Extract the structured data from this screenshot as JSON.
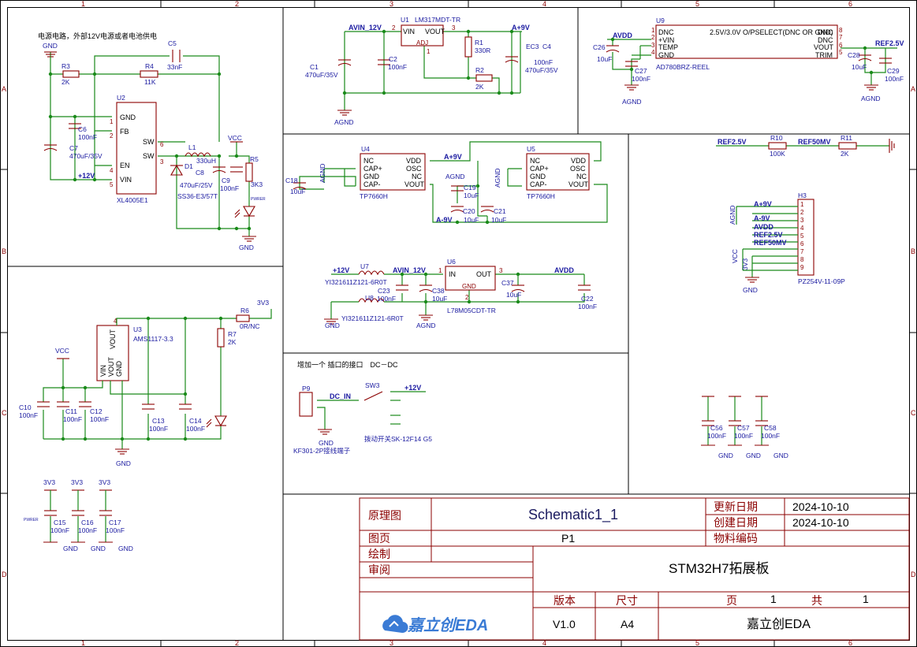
{
  "sheet": {
    "col_markers": [
      "1",
      "2",
      "3",
      "4",
      "5",
      "6"
    ],
    "row_markers": [
      "A",
      "B",
      "C",
      "D"
    ]
  },
  "power_section": {
    "note": "电源电路，外部12V电源或者电池供电",
    "parts": {
      "c5": {
        "ref": "C5",
        "value": "33nF"
      },
      "r3": {
        "ref": "R3",
        "value": "2K"
      },
      "r4": {
        "ref": "R4",
        "value": "11K"
      },
      "u2": {
        "ref": "U2",
        "value": "XL4005E1",
        "pins": [
          "GND",
          "FB",
          "EN",
          "VIN",
          "SW",
          "SW"
        ],
        "pin_numbers": [
          "1",
          "2",
          "4",
          "5",
          "6",
          "3"
        ]
      },
      "c6": {
        "ref": "C6",
        "value": "100nF"
      },
      "c7": {
        "ref": "C7",
        "value": "470uF/35V"
      },
      "l1": {
        "ref": "L1",
        "value": "330uH"
      },
      "d1": {
        "ref": "D1",
        "value": "SS36-E3/57T"
      },
      "c8": {
        "ref": "C8",
        "value": "470uF/25V"
      },
      "c9": {
        "ref": "C9",
        "value": "100nF"
      },
      "r5": {
        "ref": "R5",
        "value": "3K3"
      },
      "led": {
        "value": "PWRER"
      }
    },
    "nets": {
      "gnd": "GND",
      "vcc": "VCC",
      "v12": "+12V"
    }
  },
  "ldo_section": {
    "nets": {
      "avin": "AVIN_12V",
      "a9": "A+9V",
      "agnd": "AGND"
    },
    "parts": {
      "u1": {
        "ref": "U1",
        "value": "LM317MDT-TR",
        "pins": [
          "VIN",
          "VOUT",
          "ADJ"
        ],
        "pin_numbers": [
          "2",
          "3",
          "1"
        ]
      },
      "c1": {
        "ref": "C1",
        "value": "470uF/35V"
      },
      "c2": {
        "ref": "C2",
        "value": "100nF"
      },
      "r1": {
        "ref": "R1",
        "value": "330R"
      },
      "r2": {
        "ref": "R2",
        "value": "2K"
      },
      "ec3": {
        "ref": "EC3",
        "value": ""
      },
      "c4": {
        "ref": "C4",
        "value": "100nF"
      },
      "c4b": {
        "value": "470uF/35V"
      }
    }
  },
  "ref_section": {
    "nets": {
      "avdd": "AVDD",
      "ref25": "REF2.5V",
      "agnd": "AGND"
    },
    "parts": {
      "u9": {
        "ref": "U9",
        "value": "AD780BRZ-REEL",
        "title": "2.5V/3.0V O/PSELECT(DNC OR GND)",
        "pins_left": [
          "DNC",
          "+VIN",
          "TEMP",
          "GND"
        ],
        "pins_right": [
          "DNC",
          "DNC",
          "VOUT",
          "TRIM"
        ],
        "pin_left_numbers": [
          "1",
          "2",
          "3",
          "4"
        ],
        "pin_right_numbers": [
          "8",
          "7",
          "6",
          "5"
        ]
      },
      "c26": {
        "ref": "C26",
        "value": "10uF"
      },
      "c27": {
        "ref": "C27",
        "value": "100nF"
      },
      "c28": {
        "ref": "C28",
        "value": "10uF"
      },
      "c29": {
        "ref": "C29",
        "value": "100nF"
      }
    }
  },
  "inverter_section": {
    "nets": {
      "a9": "A+9V",
      "am9": "A-9V",
      "agnd": "AGND"
    },
    "parts": {
      "u4": {
        "ref": "U4",
        "value": "TP7660H",
        "pins_left": [
          "NC",
          "CAP+",
          "GND",
          "CAP-"
        ],
        "pins_right": [
          "VDD",
          "OSC",
          "NC",
          "VOUT"
        ]
      },
      "u5": {
        "ref": "U5",
        "value": "TP7660H",
        "pins_left": [
          "NC",
          "CAP+",
          "GND",
          "CAP-"
        ],
        "pins_right": [
          "VDD",
          "OSC",
          "NC",
          "VOUT"
        ]
      },
      "c18": {
        "ref": "C18",
        "value": "10uF"
      },
      "c19": {
        "ref": "C19",
        "value": "10uF"
      },
      "c20": {
        "ref": "C20",
        "value": "10uF"
      },
      "c21": {
        "ref": "C21",
        "value": "10uF"
      }
    }
  },
  "divider_section": {
    "nets": {
      "ref25": "REF2.5V",
      "ref50": "REF50MV"
    },
    "parts": {
      "r10": {
        "ref": "R10",
        "value": "100K"
      },
      "r11": {
        "ref": "R11",
        "value": "2K"
      }
    }
  },
  "header_section": {
    "ref": "H3",
    "value": "PZ254V-11-09P",
    "signals": [
      "AGND",
      "A+9V",
      "A-9V",
      "AVDD",
      "REF2.5V",
      "REF50MV",
      "VCC",
      "3V3"
    ],
    "pin_numbers": [
      "1",
      "2",
      "3",
      "4",
      "5",
      "6",
      "7",
      "8",
      "9"
    ],
    "gnd": "GND"
  },
  "filter_section": {
    "nets": {
      "v12": "+12V",
      "avin": "AVIN_12V",
      "avdd": "AVDD",
      "gnd": "GND",
      "agnd": "AGND"
    },
    "parts": {
      "u7": {
        "ref": "U7",
        "value": "YI321611Z121-6R0T"
      },
      "u8": {
        "ref": "U8",
        "value": "YI321611Z121-6R0T"
      },
      "c23": {
        "ref": "C23",
        "value": "100nF"
      },
      "u6": {
        "ref": "U6",
        "value": "L78M05CDT-TR",
        "pins": [
          "IN",
          "OUT",
          "GND"
        ],
        "pin_numbers": [
          "1",
          "3",
          "2"
        ]
      },
      "c38": {
        "ref": "C38",
        "value": "10uF"
      },
      "c37": {
        "ref": "C37",
        "value": "10uF"
      },
      "c22": {
        "ref": "C22",
        "value": "100nF"
      }
    }
  },
  "ams_section": {
    "nets": {
      "v33": "3V3",
      "vcc": "VCC",
      "gnd": "GND"
    },
    "parts": {
      "u3": {
        "ref": "U3",
        "value": "AMS1117-3.3",
        "pins": [
          "VOUT",
          "VIN",
          "VOUT",
          "GND"
        ],
        "pin_top": "4"
      },
      "r6": {
        "ref": "R6",
        "value": "0R/NC"
      },
      "r7": {
        "ref": "R7",
        "value": "2K"
      },
      "c10": {
        "ref": "C10",
        "value": "100nF"
      },
      "c11": {
        "ref": "C11",
        "value": "100nF"
      },
      "c12": {
        "ref": "C12",
        "value": "100nF"
      },
      "c13": {
        "ref": "C13",
        "value": "100nF"
      },
      "c14": {
        "ref": "C14",
        "value": "100nF"
      }
    }
  },
  "dcdc_section": {
    "note": "增加一个 插口的接口　DC－DC",
    "nets": {
      "dcin": "DC_IN",
      "v12": "+12V",
      "gnd": "GND"
    },
    "parts": {
      "p9": {
        "ref": "P9",
        "value": "KF301-2P接线端子"
      },
      "sw3": {
        "ref": "SW3",
        "value": "拨动开关SK-12F14 G5"
      }
    }
  },
  "decoupling_bottom_left": {
    "nets": [
      "3V3",
      "3V3",
      "3V3"
    ],
    "gnd": "GND",
    "pwr_label": "PWRER",
    "parts": [
      {
        "ref": "C15",
        "value": "100nF"
      },
      {
        "ref": "C16",
        "value": "100nF"
      },
      {
        "ref": "C17",
        "value": "100nF"
      }
    ]
  },
  "decoupling_bottom_right": {
    "gnd": "GND",
    "parts": [
      {
        "ref": "C56",
        "value": "100nF"
      },
      {
        "ref": "C57",
        "value": "100nF"
      },
      {
        "ref": "C58",
        "value": "100nF"
      }
    ]
  },
  "title_block": {
    "drawing_label": "原理图",
    "drawing_value": "Schematic1_1",
    "update_label": "更新日期",
    "update_value": "2024-10-10",
    "create_label": "创建日期",
    "create_value": "2024-10-10",
    "page_label": "图页",
    "page_value": "P1",
    "material_label": "物料编码",
    "draw_label": "绘制",
    "review_label": "审阅",
    "project": "STM32H7拓展板",
    "version_label": "版本",
    "size_label": "尺寸",
    "page_no_label": "页",
    "page_no": "1",
    "total_label": "共",
    "total": "1",
    "version": "V1.0",
    "size": "A4",
    "company": "嘉立创EDA",
    "logo": "嘉立创EDA"
  },
  "colors": {
    "wire": "#1a8a1a",
    "part": "#8b0000",
    "label": "#1a1aa0"
  }
}
